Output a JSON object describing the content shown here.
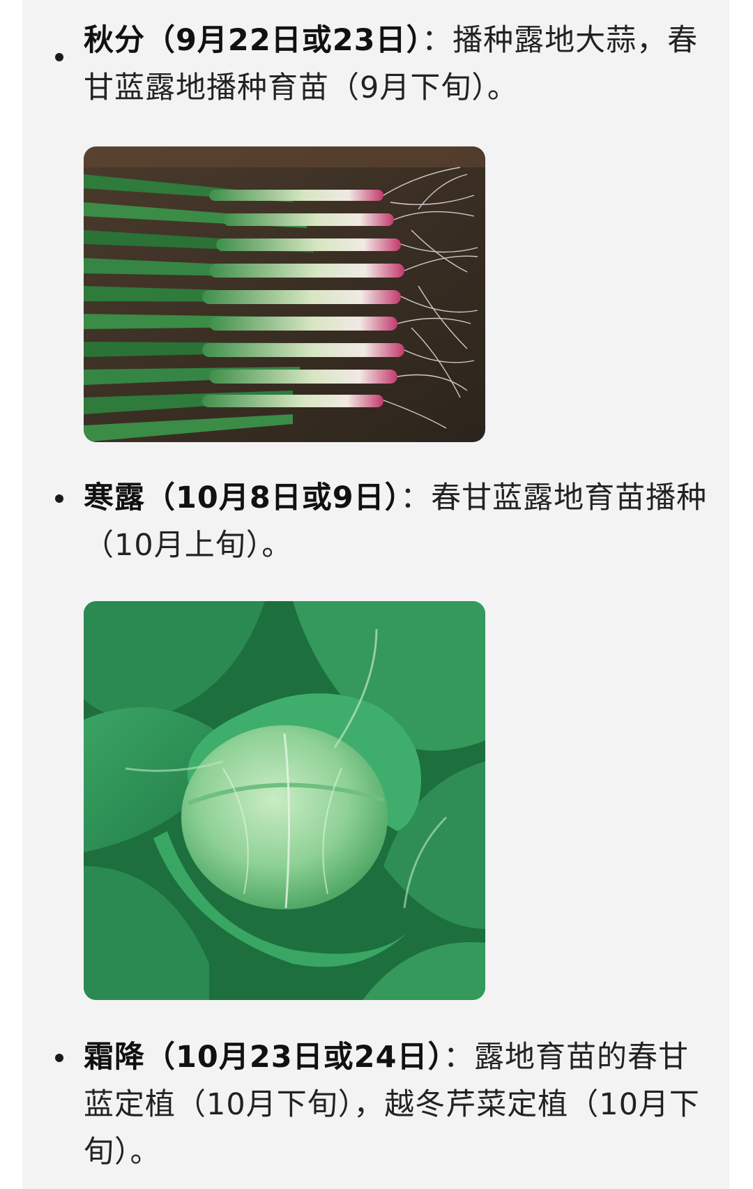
{
  "items": [
    {
      "term": "秋分（9月22日或23日）",
      "desc": "：播种露地大蒜，春甘蓝露地播种育苗（9月下旬）。"
    },
    {
      "term": "寒露（10月8日或9日）",
      "desc": "：春甘蓝露地育苗播种（10月上旬）。"
    },
    {
      "term": "霜降（10月23日或24日）",
      "desc": "：露地育苗的春甘蓝定植（10月下旬），越冬芹菜定植（10月下旬）。"
    }
  ],
  "images": {
    "garlic": {
      "subject": "garlic-seedlings-photo"
    },
    "cabbage": {
      "subject": "cabbage-head-photo"
    }
  },
  "colors": {
    "page_background": "#f3f3f4",
    "text": "#222222",
    "leaf_green": "#2f9a55",
    "root_pink": "#c23a6e"
  }
}
